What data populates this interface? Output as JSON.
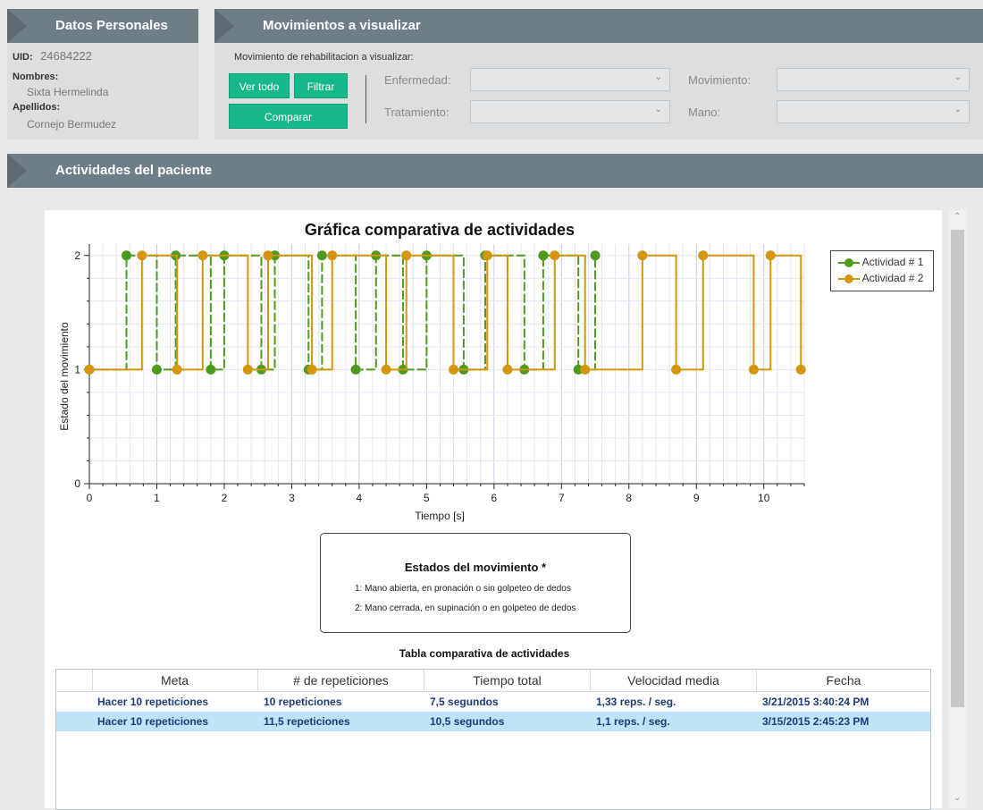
{
  "patient": {
    "header": "Datos Personales",
    "uid_label": "UID:",
    "uid": "24684222",
    "names_label": "Nombres:",
    "names": "Sixta Hermelinda",
    "surnames_label": "Apellidos:",
    "surnames": "Cornejo Bermudez"
  },
  "filters": {
    "header": "Movimientos a visualizar",
    "subtitle": "Movimiento de rehabilitacion a visualizar:",
    "btn_view_all": "Ver todo",
    "btn_filter": "Filtrar",
    "btn_compare": "Comparar",
    "disease_label": "Enfermedad:",
    "disease_value": "",
    "treatment_label": "Tratamiento:",
    "treatment_value": "",
    "movement_label": "Movimiento:",
    "movement_value": "",
    "hand_label": "Mano:",
    "hand_value": ""
  },
  "activities_header": "Actividades del paciente",
  "states": {
    "title": "Estados del movimiento *",
    "items": [
      "1:  Mano abierta, en pronación o sin golpeteo de dedos",
      "2:  Mano cerrada, en supinación o en golpeteo de dedos"
    ]
  },
  "table": {
    "title": "Tabla comparativa de actividades",
    "columns": [
      "Meta",
      "# de repeticiones",
      "Tiempo total",
      "Velocidad media",
      "Fecha"
    ],
    "rows": [
      [
        "Hacer 10 repeticiones",
        "10 repeticiones",
        "7,5 segundos",
        "1,33 reps. / seg.",
        "3/21/2015 3:40:24 PM"
      ],
      [
        "Hacer 10 repeticiones",
        "11,5 repeticiones",
        "10,5 segundos",
        "1,1 reps. / seg.",
        "3/15/2015 2:45:23 PM"
      ]
    ],
    "selected_row": 1
  },
  "colors": {
    "series1": "#4e9a1e",
    "series2": "#d4960f",
    "header_bar": "#6f7d86",
    "button": "#17b889",
    "selected_row": "#bfe3f7"
  },
  "chart_data": {
    "type": "line",
    "title": "Gráfica comparativa de actividades",
    "xlabel": "Tiempo [s]",
    "ylabel": "Estado del movimiento",
    "xlim": [
      0,
      10.6
    ],
    "ylim": [
      0,
      2.1
    ],
    "xticks": [
      0,
      1,
      2,
      3,
      4,
      5,
      6,
      7,
      8,
      9,
      10
    ],
    "yticks": [
      0,
      1,
      2
    ],
    "grid": true,
    "step": true,
    "legend_position": "top-right",
    "series": [
      {
        "name": "Actividad # 1",
        "x": [
          0,
          0.55,
          1.0,
          1.28,
          1.8,
          2.0,
          2.55,
          2.75,
          3.25,
          3.45,
          3.95,
          4.25,
          4.65,
          5.0,
          5.55,
          5.87,
          6.45,
          6.73,
          7.25,
          7.5
        ],
        "y": [
          1,
          2,
          1,
          2,
          1,
          2,
          1,
          2,
          1,
          2,
          1,
          2,
          1,
          2,
          1,
          2,
          1,
          2,
          1,
          2
        ]
      },
      {
        "name": "Actividad # 2",
        "x": [
          0,
          0.78,
          1.3,
          1.68,
          2.35,
          2.65,
          3.3,
          3.6,
          4.4,
          4.7,
          5.4,
          5.9,
          6.2,
          6.9,
          7.35,
          8.2,
          8.7,
          9.1,
          9.85,
          10.1,
          10.55
        ],
        "y": [
          1,
          2,
          1,
          2,
          1,
          2,
          1,
          2,
          1,
          2,
          1,
          2,
          1,
          2,
          1,
          2,
          1,
          2,
          1,
          2,
          1
        ]
      }
    ]
  }
}
